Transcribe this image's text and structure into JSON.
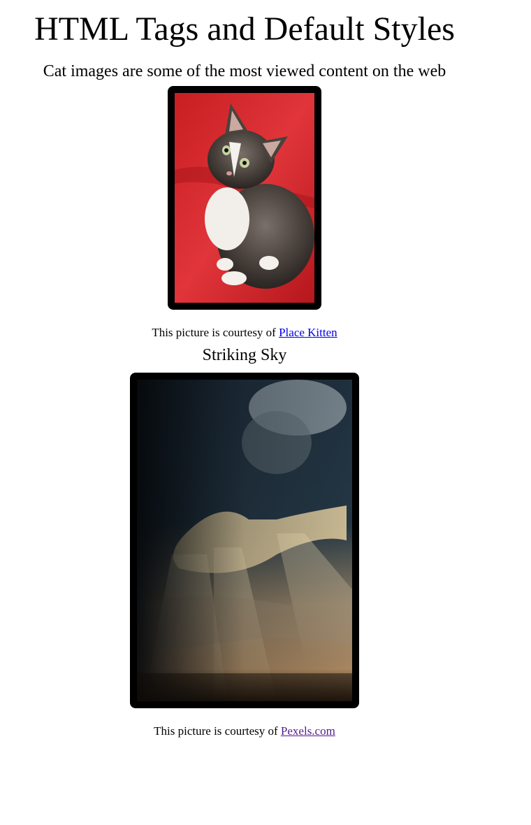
{
  "page": {
    "title": "HTML Tags and Default Styles",
    "subtitle": "Cat images are some of the most viewed content on the web"
  },
  "kitten": {
    "caption_prefix": "This picture is courtesy of",
    "link_label": "Place Kitten",
    "link_color": "#0000ee"
  },
  "sky": {
    "heading": "Striking Sky",
    "caption_prefix": "This picture is courtesy of",
    "link_label": "Pexels.com",
    "link_color": "#551a8b"
  },
  "colors": {
    "frame": "#000000",
    "background": "#ffffff",
    "kitten_backdrop": "#d8262a"
  }
}
